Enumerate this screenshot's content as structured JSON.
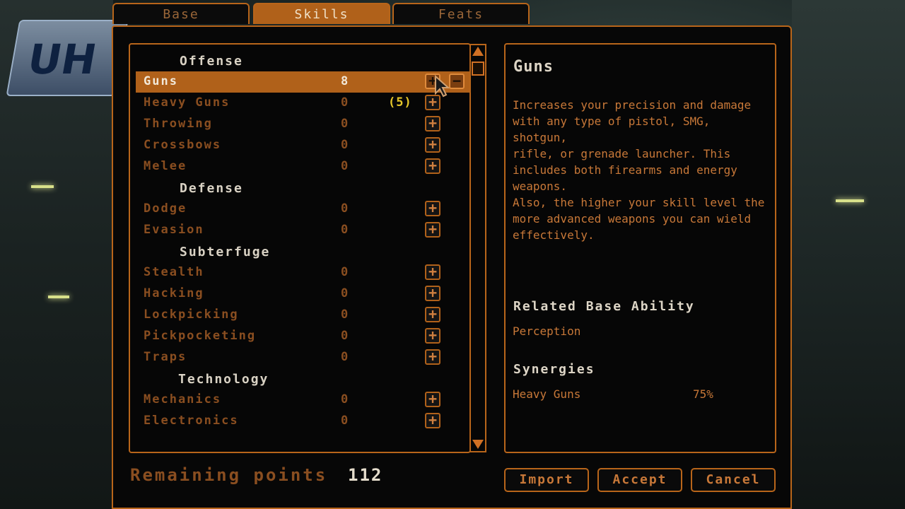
{
  "tabs": [
    "Base",
    "Skills",
    "Feats"
  ],
  "active_tab": "Skills",
  "logo_text": "UH",
  "skills": {
    "offense_header": "Offense",
    "defense_header": "Defense",
    "subterfuge_header": "Subterfuge",
    "technology_header": "Technology",
    "guns": {
      "name": "Guns",
      "value": "8"
    },
    "heavy_guns": {
      "name": "Heavy Guns",
      "value": "0",
      "bonus": "(5)"
    },
    "throwing": {
      "name": "Throwing",
      "value": "0"
    },
    "crossbows": {
      "name": "Crossbows",
      "value": "0"
    },
    "melee": {
      "name": "Melee",
      "value": "0"
    },
    "dodge": {
      "name": "Dodge",
      "value": "0"
    },
    "evasion": {
      "name": "Evasion",
      "value": "0"
    },
    "stealth": {
      "name": "Stealth",
      "value": "0"
    },
    "hacking": {
      "name": "Hacking",
      "value": "0"
    },
    "lockpicking": {
      "name": "Lockpicking",
      "value": "0"
    },
    "pickpocketing": {
      "name": "Pickpocketing",
      "value": "0"
    },
    "traps": {
      "name": "Traps",
      "value": "0"
    },
    "mechanics": {
      "name": "Mechanics",
      "value": "0"
    },
    "electronics": {
      "name": "Electronics",
      "value": "0"
    }
  },
  "buttons": {
    "plus": "+",
    "minus": "−"
  },
  "description": {
    "title": "Guns",
    "para1": "Increases your precision and damage\nwith any type of pistol, SMG, shotgun,\nrifle, or grenade launcher. This\nincludes both firearms and energy\nweapons.",
    "para2": "Also, the higher your skill level the\nmore advanced weapons you can wield\neffectively.",
    "related_header": "Related Base Ability",
    "related_value": "Perception",
    "synergies_header": "Synergies",
    "synergy_name": "Heavy Guns",
    "synergy_value": "75%"
  },
  "remaining": {
    "label": "Remaining points",
    "value": "112"
  },
  "actions": {
    "import": "Import",
    "accept": "Accept",
    "cancel": "Cancel"
  },
  "colors": {
    "accent": "#b8651a",
    "highlight": "#b0611a",
    "bonus": "#e5c629"
  }
}
